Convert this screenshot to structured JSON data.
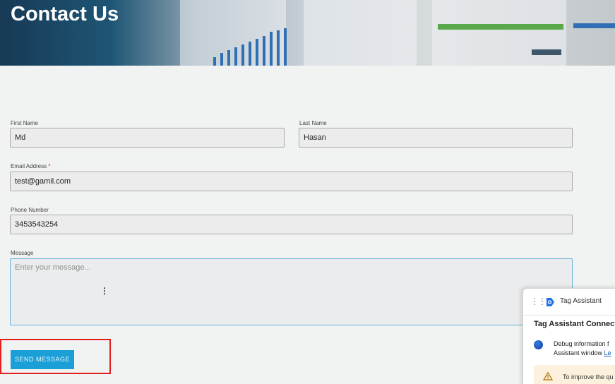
{
  "hero": {
    "title": "Contact Us"
  },
  "form": {
    "first_name": {
      "label": "First Name",
      "value": "Md"
    },
    "last_name": {
      "label": "Last Name",
      "value": "Hasan"
    },
    "email": {
      "label": "Email Address",
      "required_mark": "*",
      "value": "test@gamil.com"
    },
    "phone": {
      "label": "Phone Number",
      "value": "3453543254"
    },
    "message": {
      "label": "Message",
      "placeholder": "Enter your message...",
      "value": ""
    },
    "submit_label": "SEND MESSAGE"
  },
  "tag_assistant": {
    "title": "Tag Assistant",
    "subtitle": "Tag Assistant Connect",
    "debug_line1": "Debug information f",
    "debug_line2": "Assistant window",
    "debug_link": "Le",
    "warning_text": "To improve the qu"
  },
  "colors": {
    "accent": "#1a9fd6",
    "highlight": "#e32020",
    "hero_dark": "#173a55"
  },
  "icons": {
    "drag": "drag-handle-icon",
    "logo": "tag-assistant-logo-icon",
    "status": "status-dot-icon",
    "warning": "warning-icon"
  }
}
